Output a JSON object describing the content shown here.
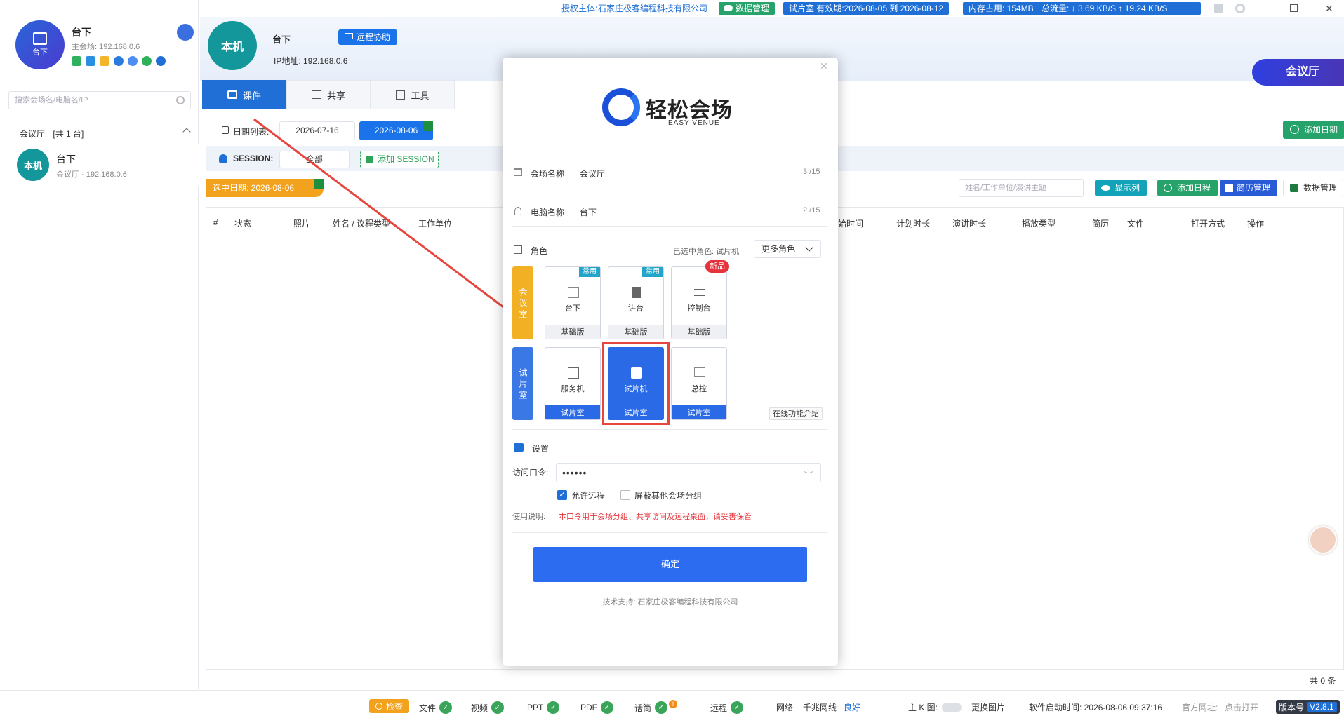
{
  "topbar": {
    "auth_label": "授权主体:",
    "auth_company": "石家庄极客编程科技有限公司",
    "data_mgmt": "数据管理",
    "trial": "试片室 有效期:2026-08-05 到 2026-08-12",
    "memory": "内存占用: 154MB",
    "traffic": "总流量: ↓ 3.69 KB/S   ↑ 19.24 KB/S"
  },
  "sidebar": {
    "device_name": "台下",
    "avatar_label": "台下",
    "main_venue": "主会场: 192.168.0.6",
    "search_placeholder": "搜索会场名/电脑名/IP",
    "group_label": "会议厅",
    "group_count": "[共 1 台]",
    "item": {
      "avatar": "本机",
      "name": "台下",
      "sub": "会议厅 · 192.168.0.6"
    }
  },
  "header": {
    "avatar": "本机",
    "name": "台下",
    "remote_btn": "远程协助",
    "ip": "IP地址: 192.168.0.6",
    "venue_badge": "会议厅"
  },
  "tabs": [
    "课件",
    "共享",
    "工具"
  ],
  "dates": {
    "label": "日期列表:",
    "d1": "2026-07-16",
    "d2": "2026-08-06",
    "add_date": "添加日期"
  },
  "session": {
    "label": "SESSION:",
    "value": "全部",
    "add": "添加 SESSION"
  },
  "selected_date": "选中日期: 2026-08-06",
  "toolbar": {
    "search_placeholder": "姓名/工作单位/演讲主题",
    "show_cols": "显示列",
    "add_schedule": "添加日程",
    "cv_mgmt": "简历管理",
    "data_mgmt": "数据管理"
  },
  "table": {
    "headers": [
      "#",
      "状态",
      "照片",
      "姓名 / 议程类型",
      "工作单位",
      "开始时间",
      "计划时长",
      "演讲时长",
      "播放类型",
      "简历",
      "文件",
      "打开方式",
      "操作"
    ],
    "total": "共 0 条"
  },
  "modal": {
    "brand_cn": "轻松会场",
    "brand_en": "EASY VENUE",
    "venue_label": "会场名称",
    "venue_value": "会议厅",
    "venue_count": "3 /15",
    "pc_label": "电脑名称",
    "pc_value": "台下",
    "pc_count": "2 /15",
    "role_label": "角色",
    "selected_role": "已选中角色: 试片机",
    "more_roles": "更多角色",
    "group1": "会议室",
    "group2": "试片室",
    "roles_row1": [
      {
        "name": "台下",
        "foot": "基础版",
        "tag": "常用"
      },
      {
        "name": "讲台",
        "foot": "基础版",
        "tag": "常用"
      },
      {
        "name": "控制台",
        "foot": "基础版",
        "tag": "新品"
      }
    ],
    "roles_row2": [
      {
        "name": "服务机",
        "foot": "试片室"
      },
      {
        "name": "试片机",
        "foot": "试片室"
      },
      {
        "name": "总控",
        "foot": "试片室"
      }
    ],
    "online_intro": "在线功能介绍",
    "settings": "设置",
    "password_label": "访问口令:",
    "password_value": "••••••",
    "allow_remote": "允许远程",
    "block_other": "屏蔽其他会场分组",
    "usage_label": "使用说明:",
    "usage_text": "本口令用于会场分组、共享访问及远程桌面，请妥善保管",
    "confirm": "确定",
    "support": "技术支持: 石家庄极客编程科技有限公司"
  },
  "statusbar": {
    "check": "检查",
    "file": "文件",
    "video": "视频",
    "ppt": "PPT",
    "pdf": "PDF",
    "mic": "话筒",
    "mic_badge": "!",
    "remote": "远程",
    "network": "网络",
    "gigabit": "千兆网线",
    "good": "良好",
    "main_k": "主 K 图:",
    "change_img": "更换图片",
    "start_time": "软件启动时间: 2026-08-06 09:37:16",
    "website": "官方网址:",
    "open_click": "点击打开",
    "version_lbl": "版本号",
    "version": "V2.8.1"
  },
  "colors": {
    "primary": "#1f6fd6",
    "green": "#25a36a",
    "orange": "#f2a21c",
    "red": "#e5323b",
    "teal": "#14979a"
  }
}
